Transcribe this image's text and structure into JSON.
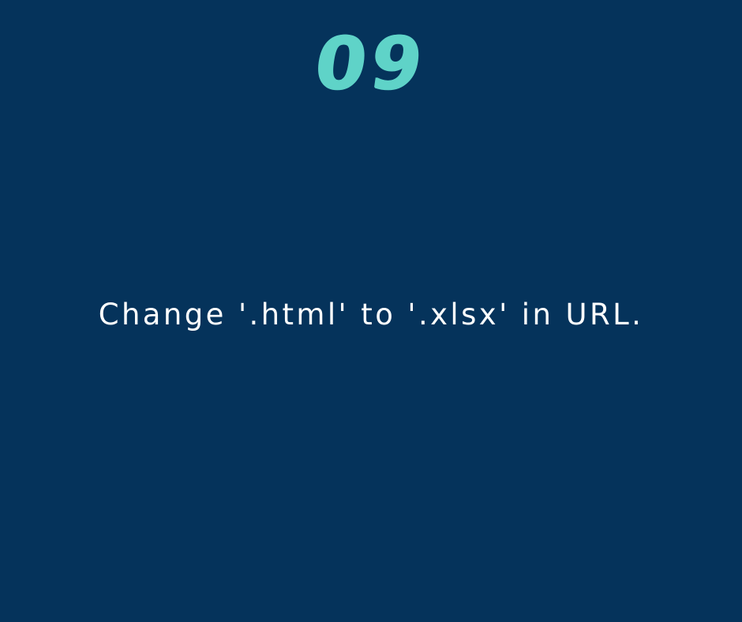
{
  "slide": {
    "number": "09",
    "instruction": "Change '.html' to '.xlsx' in URL."
  },
  "colors": {
    "background": "#05335b",
    "number_accent": "#5fd3c8",
    "instruction_text": "#ffffff"
  }
}
